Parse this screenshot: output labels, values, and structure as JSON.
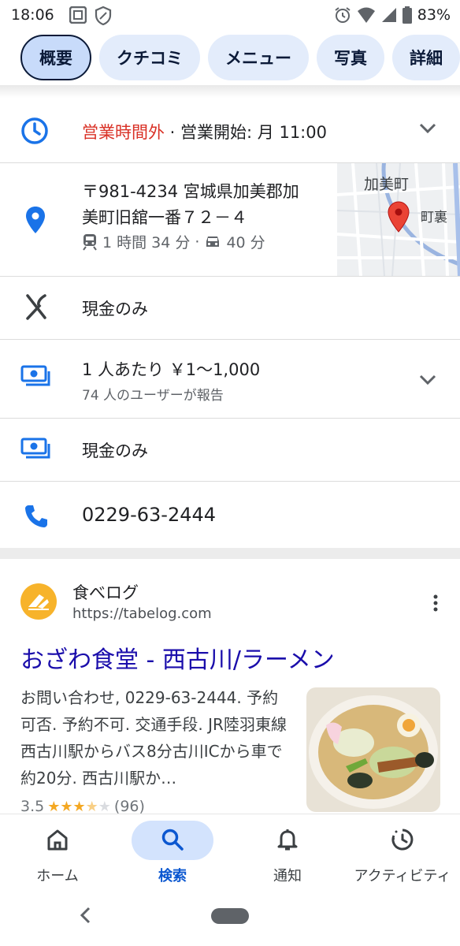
{
  "status_bar": {
    "time": "18:06",
    "battery": "83%",
    "icons": [
      "grid-icon",
      "shield-icon",
      "alarm-icon",
      "wifi-icon",
      "signal-icon",
      "battery-icon"
    ]
  },
  "chips": [
    {
      "label": "概要",
      "active": true
    },
    {
      "label": "クチコミ",
      "active": false
    },
    {
      "label": "メニュー",
      "active": false
    },
    {
      "label": "写真",
      "active": false
    },
    {
      "label": "詳細",
      "active": false
    }
  ],
  "hours": {
    "status": "営業時間外",
    "separator": " · ",
    "next_open": "営業開始: 月 11:00"
  },
  "address": {
    "line1": "〒981-4234 宮城県加美郡加",
    "line2": "美町旧舘一番７２－４",
    "transit_time": "1 時間 34 分",
    "dot": "·",
    "drive_time": "40 分",
    "map_label_town": "加美町",
    "map_label_area": "町裏"
  },
  "payment_row": {
    "label": "現金のみ"
  },
  "price_row": {
    "label": "1 人あたり ￥1～1,000",
    "sub": "74 人のユーザーが報告"
  },
  "cash_row": {
    "label": "現金のみ"
  },
  "phone_row": {
    "label": "0229-63-2444"
  },
  "result": {
    "site_name": "食べログ",
    "site_url": "https://tabelog.com",
    "title": "おざわ食堂 - 西古川/ラーメン",
    "snippet": "お問い合わせ, 0229-63-2444. 予約可否. 予約不可. 交通手段. JR陸羽東線西古川駅からバス8分古川ICから車で約20分. 西古川駅か…",
    "rating": "3.5",
    "rating_value": 3.5,
    "review_count": "(96)"
  },
  "bottom_nav": [
    {
      "label": "ホーム",
      "icon": "home-icon",
      "active": false
    },
    {
      "label": "検索",
      "icon": "search-icon",
      "active": true
    },
    {
      "label": "通知",
      "icon": "bell-icon",
      "active": false
    },
    {
      "label": "アクティビティ",
      "icon": "activity-icon",
      "active": false
    }
  ],
  "colors": {
    "accent_blue": "#1a73e8",
    "closed_red": "#d93025",
    "link_blue": "#1a0dab"
  }
}
